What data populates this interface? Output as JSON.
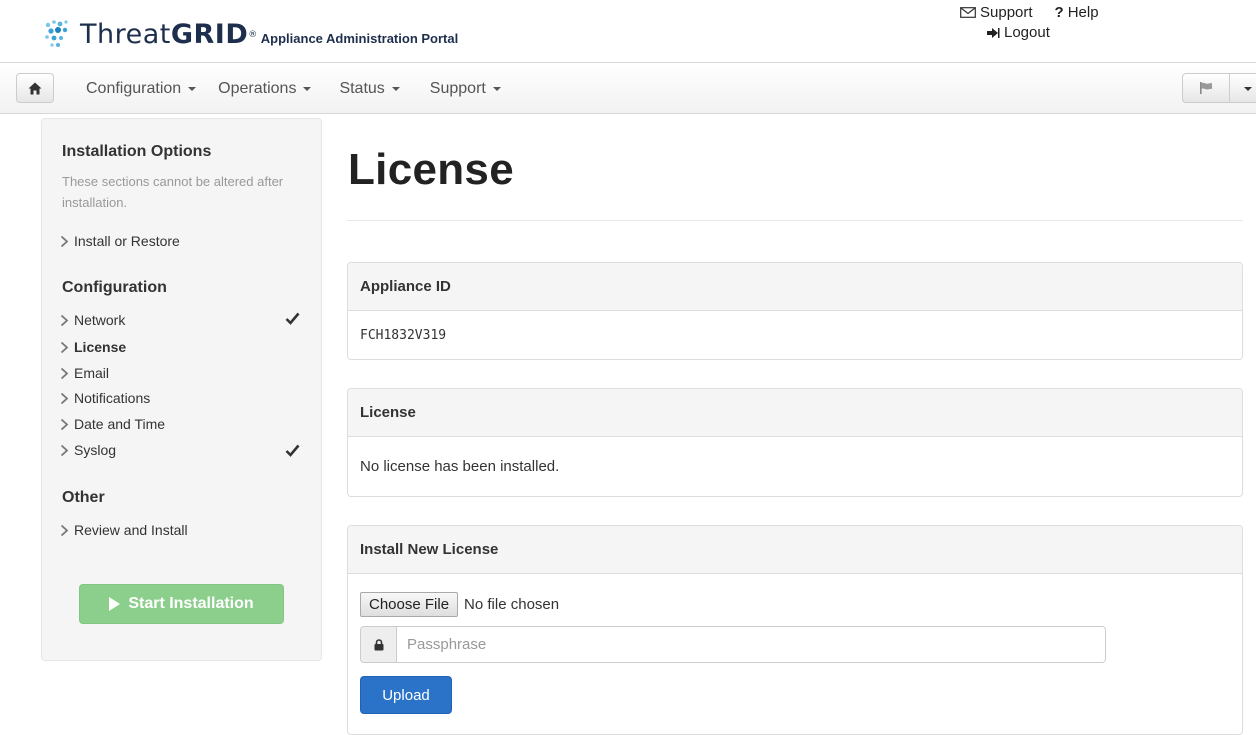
{
  "header": {
    "brand_name_part1": "Threat",
    "brand_name_part2": "GRID",
    "brand_registered": "®",
    "brand_subtitle": "Appliance Administration Portal",
    "support_label": "Support",
    "help_label": "Help",
    "help_glyph": "?",
    "logout_label": "Logout"
  },
  "navbar": {
    "items": [
      {
        "label": "Configuration"
      },
      {
        "label": "Operations"
      },
      {
        "label": "Status"
      },
      {
        "label": "Support"
      }
    ]
  },
  "sidebar": {
    "sections": [
      {
        "heading": "Installation Options",
        "note": "These sections cannot be altered after installation."
      },
      {
        "heading": "Configuration"
      },
      {
        "heading": "Other"
      }
    ],
    "install_items": [
      {
        "label": "Install or Restore"
      }
    ],
    "config_items": [
      {
        "label": "Network",
        "checked": true
      },
      {
        "label": "License",
        "active": true
      },
      {
        "label": "Email"
      },
      {
        "label": "Notifications"
      },
      {
        "label": "Date and Time"
      },
      {
        "label": "Syslog",
        "checked": true
      }
    ],
    "other_items": [
      {
        "label": "Review and Install"
      }
    ],
    "start_button_label": "Start Installation"
  },
  "main": {
    "page_title": "License",
    "appliance_panel": {
      "heading": "Appliance ID",
      "value": "FCH1832V319"
    },
    "license_panel": {
      "heading": "License",
      "value": "No license has been installed."
    },
    "install_panel": {
      "heading": "Install New License",
      "choose_file_label": "Choose File",
      "no_file_text": "No file chosen",
      "passphrase_placeholder": "Passphrase",
      "upload_label": "Upload"
    }
  },
  "colors": {
    "brand": "#1d2f4d",
    "start_button": "#8ccf8c",
    "upload_button": "#2a73c9"
  },
  "icons": {
    "home": "home-icon",
    "flag": "flag-icon",
    "support": "envelope-icon",
    "logout": "logout-icon",
    "check": "check-icon",
    "chevron": "chevron-right-icon",
    "lock": "lock-icon",
    "play": "play-icon"
  }
}
